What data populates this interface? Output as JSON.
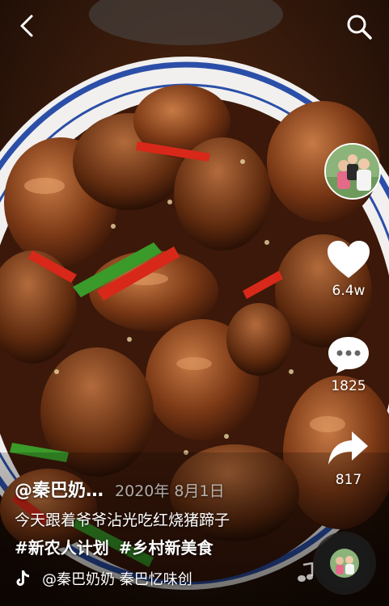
{
  "video": {
    "scene": "food"
  },
  "top_bar": {
    "back_icon": "chevron-left-icon",
    "search_icon": "search-icon"
  },
  "side_actions": {
    "like": {
      "icon": "heart-icon",
      "count": "6.4w"
    },
    "comment": {
      "icon": "comment-bubble-icon",
      "count": "1825"
    },
    "share": {
      "icon": "share-arrow-icon",
      "count": "817"
    }
  },
  "post": {
    "author": "@秦巴奶…",
    "date": "2020年 8月1日",
    "description": "今天跟着爷爷沾光吃红烧猪蹄子",
    "hashtags": [
      "#新农人计划",
      "#乡村新美食"
    ]
  },
  "music": {
    "text": "@秦巴奶奶 秦巴忆味创"
  },
  "colors": {
    "text": "#ffffff",
    "heart": "#ffffff",
    "bowl_rim": "#2b4fa8"
  }
}
